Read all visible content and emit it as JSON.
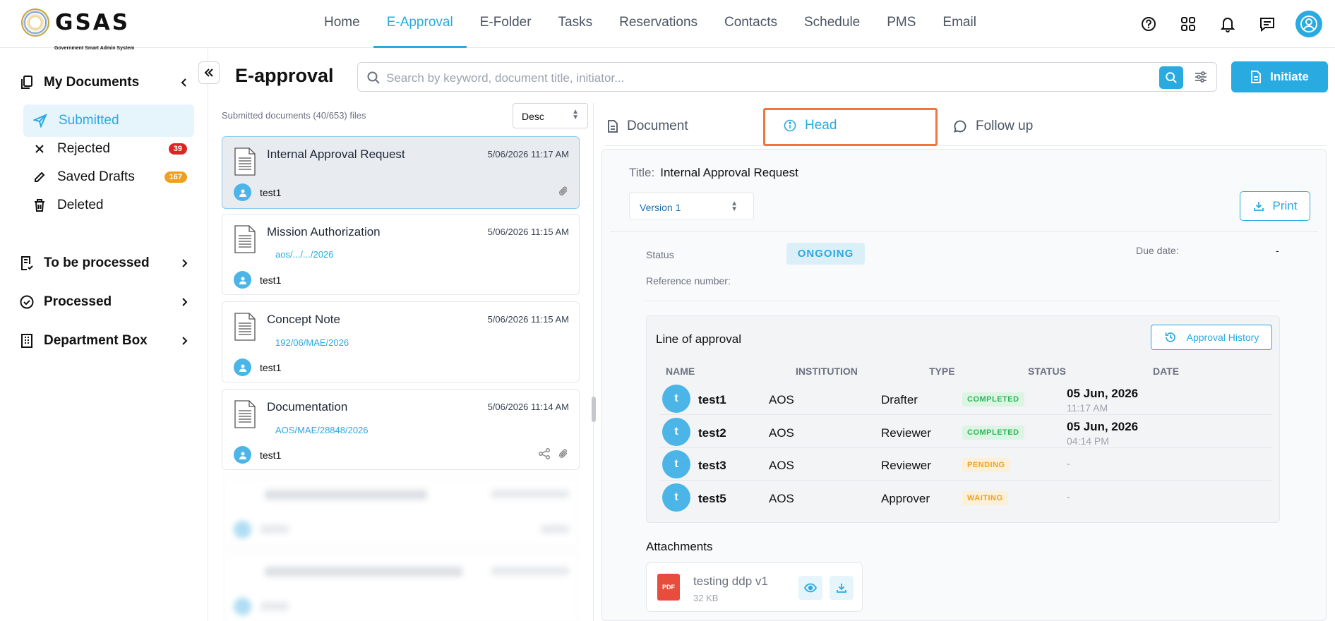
{
  "brand": {
    "name": "GSAS",
    "subtitle": "Government Smart Admin System"
  },
  "nav": [
    "Home",
    "E-Approval",
    "E-Folder",
    "Tasks",
    "Reservations",
    "Contacts",
    "Schedule",
    "PMS",
    "Email"
  ],
  "sidebar": {
    "my_documents": "My Documents",
    "items": [
      {
        "label": "Submitted",
        "badge": ""
      },
      {
        "label": "Rejected",
        "badge": "39"
      },
      {
        "label": "Saved Drafts",
        "badge": "167"
      },
      {
        "label": "Deleted",
        "badge": ""
      }
    ],
    "to_be_processed": "To be processed",
    "processed": "Processed",
    "department_box": "Department Box",
    "badge_colors": {
      "rejected": "#e02424",
      "drafts": "#f0a020"
    }
  },
  "header": {
    "title": "E-approval",
    "search_placeholder": "Search by keyword, document title, initiator...",
    "initiate": "Initiate"
  },
  "list": {
    "summary": "Submitted documents (40/653) files",
    "sort": "Desc",
    "cards": [
      {
        "title": "Internal Approval Request",
        "date": "5/06/2026 11:17 AM",
        "ref": "",
        "user": "test1"
      },
      {
        "title": "Mission Authorization",
        "date": "5/06/2026 11:15 AM",
        "ref": "aos/.../.../2026",
        "user": "test1"
      },
      {
        "title": "Concept Note",
        "date": "5/06/2026 11:15 AM",
        "ref": "192/06/MAE/2026",
        "user": "test1"
      },
      {
        "title": "Documentation",
        "date": "5/06/2026 11:14 AM",
        "ref": "AOS/MAE/28848/2026",
        "user": "test1"
      }
    ]
  },
  "detail": {
    "tabs": [
      "Document",
      "Head",
      "Follow up"
    ],
    "title_label": "Title:",
    "title_value": "Internal Approval Request",
    "version": "Version 1",
    "print": "Print",
    "status_label": "Status",
    "status_value": "ONGOING",
    "due_label": "Due date:",
    "due_value": "-",
    "ref_label": "Reference number:",
    "loa": {
      "heading": "Line of approval",
      "history_btn": "Approval History",
      "columns": [
        "NAME",
        "INSTITUTION",
        "TYPE",
        "STATUS",
        "DATE"
      ],
      "rows": [
        {
          "initial": "t",
          "name": "test1",
          "institution": "AOS",
          "type": "Drafter",
          "status": "COMPLETED",
          "date": "05 Jun, 2026",
          "time": "11:17 AM"
        },
        {
          "initial": "t",
          "name": "test2",
          "institution": "AOS",
          "type": "Reviewer",
          "status": "COMPLETED",
          "date": "05 Jun, 2026",
          "time": "04:14 PM"
        },
        {
          "initial": "t",
          "name": "test3",
          "institution": "AOS",
          "type": "Reviewer",
          "status": "PENDING",
          "date": "-",
          "time": ""
        },
        {
          "initial": "t",
          "name": "test5",
          "institution": "AOS",
          "type": "Approver",
          "status": "WAITING",
          "date": "-",
          "time": ""
        }
      ]
    },
    "attachments_heading": "Attachments",
    "attachment": {
      "type": "PDF",
      "name": "testing ddp v1",
      "size": "32 KB"
    }
  },
  "colors": {
    "accent": "#29aae1",
    "completed_bg": "#dcf5e3",
    "completed_fg": "#2fb35a",
    "pending_bg": "#fdf0d8",
    "pending_fg": "#f0a020",
    "highlight": "#f0763e"
  }
}
